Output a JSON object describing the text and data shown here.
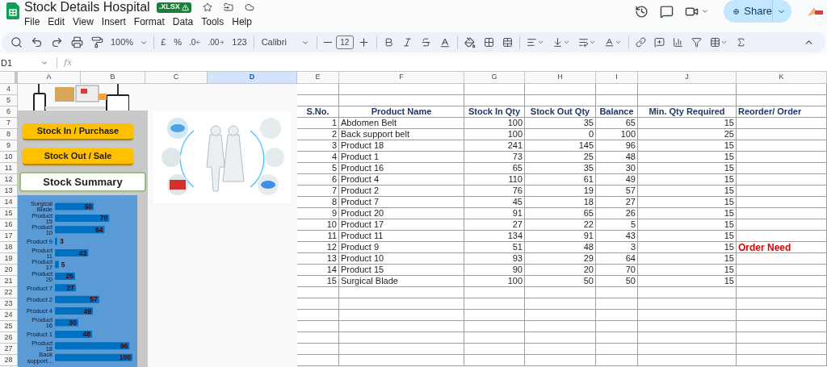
{
  "document": {
    "title": "Stock Details Hospital",
    "badge": ".XLSX"
  },
  "menu": [
    "File",
    "Edit",
    "View",
    "Insert",
    "Format",
    "Data",
    "Tools",
    "Help"
  ],
  "share_button": "Share",
  "toolbar": {
    "zoom": "100%",
    "currency": "£",
    "percent": "%",
    "decrease_decimals": ".0",
    "increase_decimals": ".00",
    "number_format": "123",
    "font": "Calibri",
    "font_size": "12"
  },
  "name_box": "D1",
  "formula_label": "fx",
  "columns": [
    {
      "label": "A",
      "selected": false
    },
    {
      "label": "B",
      "selected": false
    },
    {
      "label": "C",
      "selected": false
    },
    {
      "label": "D",
      "selected": true
    },
    {
      "label": "E",
      "selected": false
    },
    {
      "label": "F",
      "selected": false
    },
    {
      "label": "G",
      "selected": false
    },
    {
      "label": "H",
      "selected": false
    },
    {
      "label": "I",
      "selected": false
    },
    {
      "label": "J",
      "selected": false
    },
    {
      "label": "K",
      "selected": false
    }
  ],
  "row_numbers": [
    "4",
    "5",
    "6",
    "7",
    "8",
    "9",
    "10",
    "11",
    "12",
    "13",
    "14",
    "15",
    "16",
    "17",
    "18",
    "19",
    "20",
    "21",
    "22",
    "23",
    "24",
    "25",
    "26",
    "27",
    "28"
  ],
  "panel_buttons": [
    {
      "label": "Stock In / Purchase",
      "kind": "yellow"
    },
    {
      "label": "Stock Out / Sale",
      "kind": "yellow"
    },
    {
      "label": "Stock Summary",
      "kind": "outline"
    }
  ],
  "chart": {
    "chart_data": {
      "type": "bar",
      "orientation": "horizontal",
      "data_labels": true,
      "categories": [
        "Surgical Blade",
        "Product 15",
        "Product 10",
        "Product 9",
        "Product 11",
        "Product 17",
        "Product 20",
        "Product 7",
        "Product 2",
        "Product 4",
        "Product 16",
        "Product 1",
        "Product 18",
        "Back support..."
      ],
      "values": [
        50,
        70,
        64,
        3,
        43,
        5,
        26,
        27,
        57,
        49,
        30,
        48,
        96,
        100
      ]
    }
  },
  "table": {
    "columns": [
      "S.No.",
      "Product Name",
      "Stock In Qty",
      "Stock Out Qty",
      "Balance",
      "Min. Qty Required",
      "Reorder/ Order"
    ],
    "rows": [
      {
        "sno": "1",
        "product": "Abdomen Belt",
        "stock_in": "100",
        "stock_out": "35",
        "balance": "65",
        "min_qty": "15"
      },
      {
        "sno": "2",
        "product": "Back support belt",
        "stock_in": "100",
        "stock_out": "0",
        "balance": "100",
        "min_qty": "25"
      },
      {
        "sno": "3",
        "product": "Product 18",
        "stock_in": "241",
        "stock_out": "145",
        "balance": "96",
        "min_qty": "15"
      },
      {
        "sno": "4",
        "product": "Product 1",
        "stock_in": "73",
        "stock_out": "25",
        "balance": "48",
        "min_qty": "15"
      },
      {
        "sno": "5",
        "product": "Product 16",
        "stock_in": "65",
        "stock_out": "35",
        "balance": "30",
        "min_qty": "15"
      },
      {
        "sno": "6",
        "product": "Product 4",
        "stock_in": "110",
        "stock_out": "61",
        "balance": "49",
        "min_qty": "15"
      },
      {
        "sno": "7",
        "product": "Product 2",
        "stock_in": "76",
        "stock_out": "19",
        "balance": "57",
        "min_qty": "15"
      },
      {
        "sno": "8",
        "product": "Product 7",
        "stock_in": "45",
        "stock_out": "18",
        "balance": "27",
        "min_qty": "15"
      },
      {
        "sno": "9",
        "product": "Product 20",
        "stock_in": "91",
        "stock_out": "65",
        "balance": "26",
        "min_qty": "15"
      },
      {
        "sno": "10",
        "product": "Product 17",
        "stock_in": "27",
        "stock_out": "22",
        "balance": "5",
        "min_qty": "15"
      },
      {
        "sno": "11",
        "product": "Product 11",
        "stock_in": "134",
        "stock_out": "91",
        "balance": "43",
        "min_qty": "15"
      },
      {
        "sno": "12",
        "product": "Product 9",
        "stock_in": "51",
        "stock_out": "48",
        "balance": "3",
        "min_qty": "15",
        "reorder": "Order Need"
      },
      {
        "sno": "13",
        "product": "Product 10",
        "stock_in": "93",
        "stock_out": "29",
        "balance": "64",
        "min_qty": "15"
      },
      {
        "sno": "14",
        "product": "Product 15",
        "stock_in": "90",
        "stock_out": "20",
        "balance": "70",
        "min_qty": "15"
      },
      {
        "sno": "15",
        "product": "Surgical Blade",
        "stock_in": "100",
        "stock_out": "50",
        "balance": "50",
        "min_qty": "15"
      }
    ]
  }
}
